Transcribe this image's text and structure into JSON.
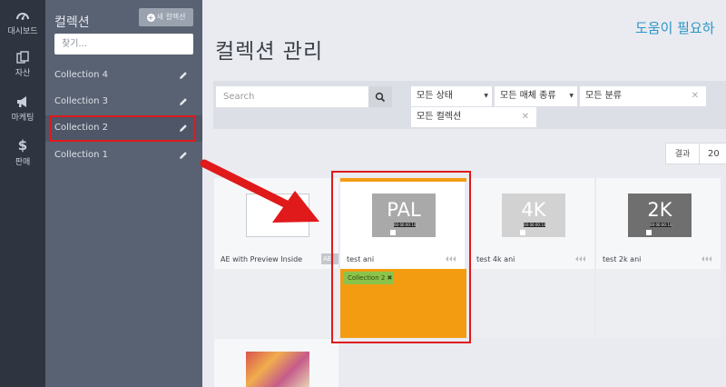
{
  "rail": {
    "items": [
      {
        "label": "대시보드",
        "icon": "dashboard-icon"
      },
      {
        "label": "자산",
        "icon": "assets-icon"
      },
      {
        "label": "마케팅",
        "icon": "megaphone-icon"
      },
      {
        "label": "판매",
        "icon": "dollar-icon"
      }
    ]
  },
  "panel": {
    "title": "컬렉션",
    "new_button": "새 컬렉션",
    "search_placeholder": "찾기...",
    "collections": [
      {
        "name": "Collection 4"
      },
      {
        "name": "Collection 3"
      },
      {
        "name": "Collection 2",
        "selected": true
      },
      {
        "name": "Collection 1"
      }
    ]
  },
  "main": {
    "title": "컬렉션 관리",
    "help": "도움이 필요하",
    "search_placeholder": "Search",
    "filters": {
      "status": "모든 상태",
      "media_type": "모든 매체 종류",
      "category": "모든 분류",
      "collection": "모든 컬렉션"
    },
    "results_label": "결과",
    "results_count": "20"
  },
  "cards": [
    {
      "title": "AE with Preview Inside",
      "badge": "AE",
      "thumb": ""
    },
    {
      "title": "test ani",
      "thumb": "PAL",
      "timecode": "00:00:00:10",
      "tag": "Collection 2 ✖"
    },
    {
      "title": "test 4k ani",
      "thumb": "4K",
      "timecode": "00:00:00:10"
    },
    {
      "title": "test 2k ani",
      "thumb": "2K",
      "timecode": "00:00:00:10"
    }
  ],
  "colors": {
    "accent": "#2d96c7",
    "highlight": "#e0191b",
    "selected_card": "#f39c12",
    "tag": "#8bc34a"
  }
}
